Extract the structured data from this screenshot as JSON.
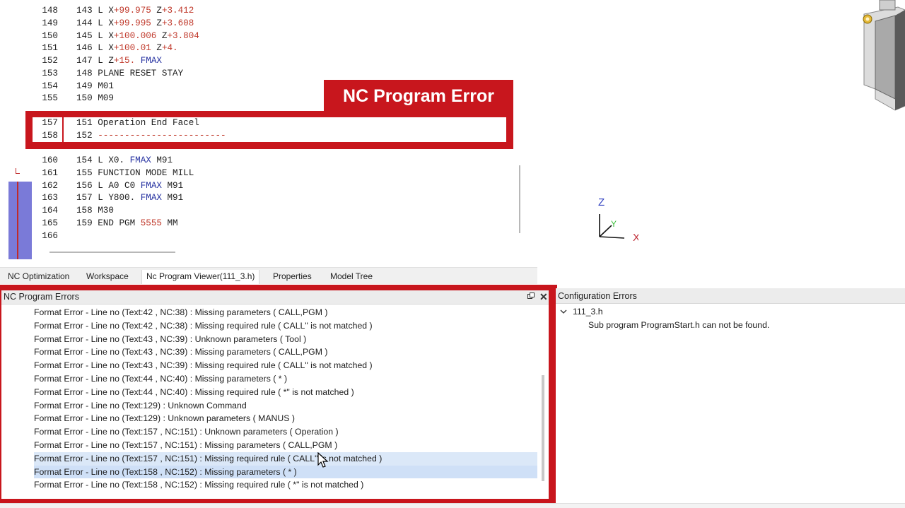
{
  "editor": {
    "lines": [
      {
        "ln": "148",
        "parts": [
          [
            "",
            "143 L X"
          ],
          [
            "num",
            "+99.975"
          ],
          [
            "",
            " Z"
          ],
          [
            "num",
            "+3.412"
          ]
        ]
      },
      {
        "ln": "149",
        "parts": [
          [
            "",
            "144 L X"
          ],
          [
            "num",
            "+99.995"
          ],
          [
            "",
            " Z"
          ],
          [
            "num",
            "+3.608"
          ]
        ]
      },
      {
        "ln": "150",
        "parts": [
          [
            "",
            "145 L X"
          ],
          [
            "num",
            "+100.006"
          ],
          [
            "",
            " Z"
          ],
          [
            "num",
            "+3.804"
          ]
        ]
      },
      {
        "ln": "151",
        "parts": [
          [
            "",
            "146 L X"
          ],
          [
            "num",
            "+100.01"
          ],
          [
            "",
            " Z"
          ],
          [
            "num",
            "+4."
          ]
        ]
      },
      {
        "ln": "152",
        "parts": [
          [
            "",
            "147 L Z"
          ],
          [
            "num",
            "+15."
          ],
          [
            "",
            " "
          ],
          [
            "kw",
            "FMAX"
          ]
        ]
      },
      {
        "ln": "153",
        "parts": [
          [
            "",
            "148 PLANE RESET STAY"
          ]
        ]
      },
      {
        "ln": "154",
        "parts": [
          [
            "",
            "149 M01"
          ]
        ]
      },
      {
        "ln": "155",
        "parts": [
          [
            "",
            "150 M09"
          ]
        ]
      },
      {
        "ln": "160",
        "parts": [
          [
            "",
            "154 L X0. "
          ],
          [
            "kw",
            "FMAX"
          ],
          [
            "",
            " M91"
          ]
        ]
      },
      {
        "ln": "161",
        "parts": [
          [
            "",
            "155 FUNCTION MODE MILL"
          ]
        ]
      },
      {
        "ln": "162",
        "parts": [
          [
            "",
            "156 L A0 C0 "
          ],
          [
            "kw",
            "FMAX"
          ],
          [
            "",
            " M91"
          ]
        ]
      },
      {
        "ln": "163",
        "parts": [
          [
            "",
            "157 L Y800. "
          ],
          [
            "kw",
            "FMAX"
          ],
          [
            "",
            " M91"
          ]
        ]
      },
      {
        "ln": "164",
        "parts": [
          [
            "",
            "158 M30"
          ]
        ]
      },
      {
        "ln": "165",
        "parts": [
          [
            "",
            "159 END PGM "
          ],
          [
            "num",
            "5555"
          ],
          [
            "",
            " MM"
          ]
        ]
      },
      {
        "ln": "166",
        "parts": [
          [
            "",
            ""
          ]
        ]
      }
    ],
    "highlighted": [
      {
        "ln": "157",
        "parts": [
          [
            "",
            "151 Operation End Facel"
          ]
        ]
      },
      {
        "ln": "158",
        "parts": [
          [
            "",
            "152 "
          ],
          [
            "num",
            "------------------------"
          ]
        ]
      }
    ],
    "badge": "NC Program Error"
  },
  "viewport": {
    "axis_z": "Z",
    "axis_y": "Y",
    "axis_x": "X"
  },
  "tabs": [
    {
      "label": "NC Optimization"
    },
    {
      "label": "Workspace"
    },
    {
      "label": "Nc Program Viewer(111_3.h)"
    },
    {
      "label": "Properties"
    },
    {
      "label": "Model Tree"
    }
  ],
  "nc_errors": {
    "title": "NC Program Errors",
    "items": [
      "Format Error - Line no (Text:42 , NC:38) : Missing parameters ( CALL,PGM )",
      "Format Error - Line no (Text:42 , NC:38) : Missing required rule ( CALL\" is not matched )",
      "Format Error - Line no (Text:43 , NC:39) : Unknown parameters ( Tool )",
      "Format Error - Line no (Text:43 , NC:39) : Missing parameters ( CALL,PGM )",
      "Format Error - Line no (Text:43 , NC:39) : Missing required rule ( CALL\" is not matched )",
      "Format Error - Line no (Text:44 , NC:40) : Missing parameters ( * )",
      "Format Error - Line no (Text:44 , NC:40) : Missing required rule ( *\" is not matched )",
      "Format Error - Line no (Text:129) : Unknown Command",
      "Format Error - Line no (Text:129) : Unknown parameters ( MANUS )",
      "Format Error - Line no (Text:157 , NC:151) : Unknown parameters ( Operation )",
      "Format Error - Line no (Text:157 , NC:151) : Missing parameters ( CALL,PGM )",
      "Format Error - Line no (Text:157 , NC:151) : Missing required rule ( CALL\" is not matched )",
      "Format Error - Line no (Text:158 , NC:152) : Missing parameters ( * )",
      "Format Error - Line no (Text:158 , NC:152) : Missing required rule ( *\" is not matched )"
    ]
  },
  "config_errors": {
    "title": "Configuration Errors",
    "node": "111_3.h",
    "child": "Sub program ProgramStart.h can not be found."
  }
}
